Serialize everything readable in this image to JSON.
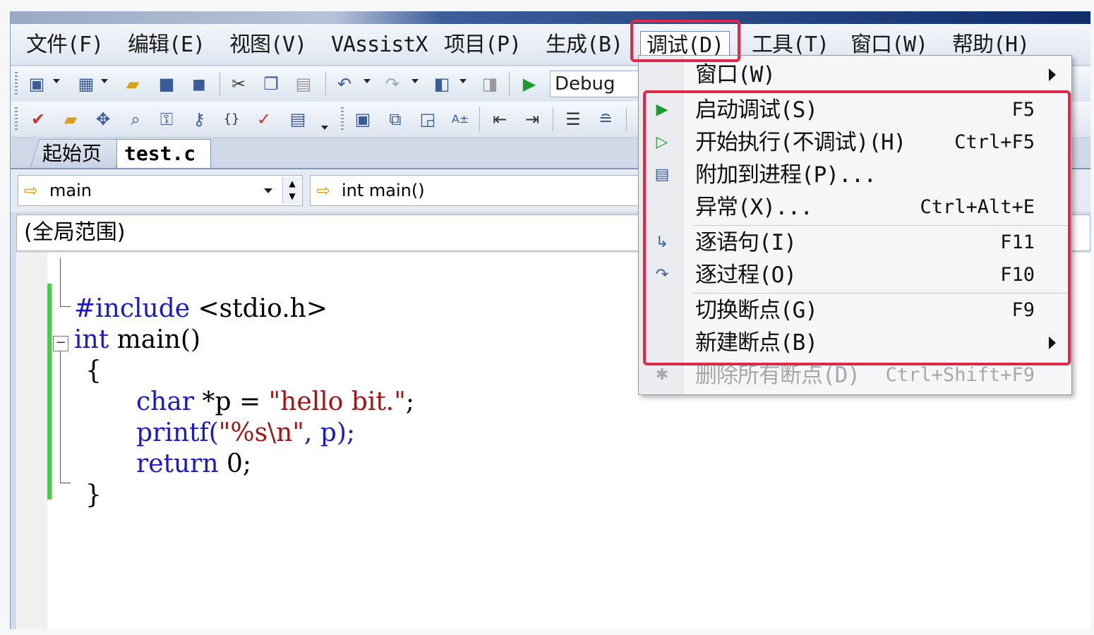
{
  "menubar": {
    "items": [
      "文件(F)",
      "编辑(E)",
      "视图(V)",
      "VAssistX",
      "项目(P)",
      "生成(B)",
      "调试(D)",
      "工具(T)",
      "窗口(W)",
      "帮助(H)"
    ],
    "active": "调试(D)"
  },
  "toolbar": {
    "config": "Debug"
  },
  "tabs": {
    "start_page": "起始页",
    "file": "test.c"
  },
  "nav": {
    "scope_combo": "main",
    "member_combo": "int main()"
  },
  "scope": "(全局范围)",
  "code": {
    "line1_directive": "#include",
    "line1_header": " <stdio.h>",
    "line2_kw": "int",
    "line2_rest": " main()",
    "line3": "{",
    "line4_kw": "char",
    "line4_mid": " *p = ",
    "line4_str": "\"hello bit.\"",
    "line4_end": ";",
    "line5_fn": "printf(",
    "line5_str": "\"%s\\n\"",
    "line5_end": ", p);",
    "line6_kw": "return",
    "line6_rest": " 0;",
    "line7": "}"
  },
  "debug_menu": {
    "window": {
      "label": "窗口(W)"
    },
    "start_debugging": {
      "label": "启动调试(S)",
      "shortcut": "F5"
    },
    "start_without": {
      "label": "开始执行(不调试)(H)",
      "shortcut": "Ctrl+F5"
    },
    "attach": {
      "label": "附加到进程(P)..."
    },
    "exceptions": {
      "label": "异常(X)...",
      "shortcut": "Ctrl+Alt+E"
    },
    "step_into": {
      "label": "逐语句(I)",
      "shortcut": "F11"
    },
    "step_over": {
      "label": "逐过程(O)",
      "shortcut": "F10"
    },
    "toggle_bp": {
      "label": "切换断点(G)",
      "shortcut": "F9"
    },
    "new_bp": {
      "label": "新建断点(B)"
    },
    "delete_all_bp": {
      "label": "删除所有断点(D)",
      "shortcut": "Ctrl+Shift+F9"
    }
  },
  "colors": {
    "highlight_box": "#e0284b",
    "keyword": "#1a1ac8",
    "string": "#a31515",
    "change_bar": "#3fd23f"
  }
}
